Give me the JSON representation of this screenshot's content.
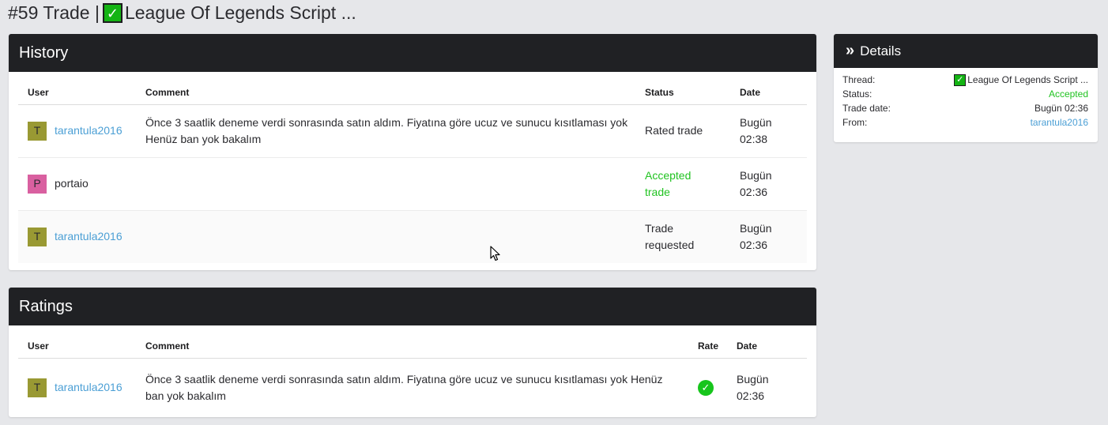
{
  "page": {
    "title_prefix": "#59 Trade | ",
    "title_check": "✓",
    "title_suffix": "League Of Legends Script ..."
  },
  "history": {
    "title": "History",
    "columns": {
      "user": "User",
      "comment": "Comment",
      "status": "Status",
      "date": "Date"
    },
    "rows": [
      {
        "avatar": "T",
        "user": "tarantula2016",
        "comment": "Önce 3 saatlik deneme verdi sonrasında satın aldım. Fiyatına göre ucuz ve sunucu kısıtlaması yok Henüz ban yok bakalım",
        "status": "Rated trade",
        "date_day": "Bugün",
        "date_time": "02:38"
      },
      {
        "avatar": "P",
        "user": "portaio",
        "comment": "",
        "status": "Accepted trade",
        "date_day": "Bugün",
        "date_time": "02:36"
      },
      {
        "avatar": "T",
        "user": "tarantula2016",
        "comment": "",
        "status": "Trade requested",
        "date_day": "Bugün",
        "date_time": "02:36"
      }
    ]
  },
  "ratings": {
    "title": "Ratings",
    "columns": {
      "user": "User",
      "comment": "Comment",
      "rate": "Rate",
      "date": "Date"
    },
    "rows": [
      {
        "avatar": "T",
        "user": "tarantula2016",
        "comment": "Önce 3 saatlik deneme verdi sonrasında satın aldım. Fiyatına göre ucuz ve sunucu kısıtlaması yok Henüz ban yok bakalım",
        "rate_icon": "check-circle-icon",
        "rate_glyph": "✓",
        "date_day": "Bugün",
        "date_time": "02:36"
      }
    ]
  },
  "details": {
    "title": "Details",
    "icon": "»",
    "thread_label": "Thread:",
    "thread_check": "✓",
    "thread_value": "League Of Legends Script ...",
    "status_label": "Status:",
    "status_value": "Accepted",
    "trade_date_label": "Trade date:",
    "trade_date_value": "Bugün 02:36",
    "from_label": "From:",
    "from_value": "tarantula2016"
  },
  "colors": {
    "header_bg": "#202124",
    "link": "#4b9fd5",
    "accepted": "#21c321",
    "avatar_t": "#999933",
    "avatar_p": "#d960a0"
  }
}
